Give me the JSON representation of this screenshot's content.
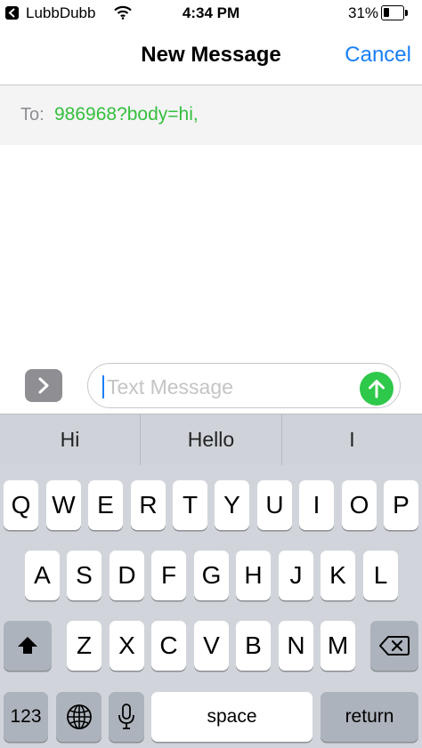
{
  "status_bar": {
    "carrier": "LubbDubb",
    "time": "4:34 PM",
    "battery_percent": "31%",
    "battery_level": 0.31
  },
  "nav": {
    "title": "New Message",
    "cancel_label": "Cancel"
  },
  "recipient": {
    "label": "To:",
    "value": "986968?body=hi,"
  },
  "compose": {
    "placeholder": "Text Message",
    "expand_icon": "chevron-right-icon",
    "send_icon": "arrow-up-icon"
  },
  "predictions": [
    "Hi",
    "Hello",
    "I"
  ],
  "keyboard": {
    "row1": [
      "Q",
      "W",
      "E",
      "R",
      "T",
      "Y",
      "U",
      "I",
      "O",
      "P"
    ],
    "row2": [
      "A",
      "S",
      "D",
      "F",
      "G",
      "H",
      "J",
      "K",
      "L"
    ],
    "row3": [
      "Z",
      "X",
      "C",
      "V",
      "B",
      "N",
      "M"
    ],
    "numbers_label": "123",
    "space_label": "space",
    "return_label": "return",
    "shift_icon": "shift-icon",
    "delete_icon": "delete-icon",
    "globe_icon": "globe-icon",
    "mic_icon": "microphone-icon"
  },
  "colors": {
    "accent": "#1a7ff5",
    "recipient_green": "#34bf3c",
    "send_green": "#2ec84a",
    "keyboard_bg": "#d1d5db"
  }
}
